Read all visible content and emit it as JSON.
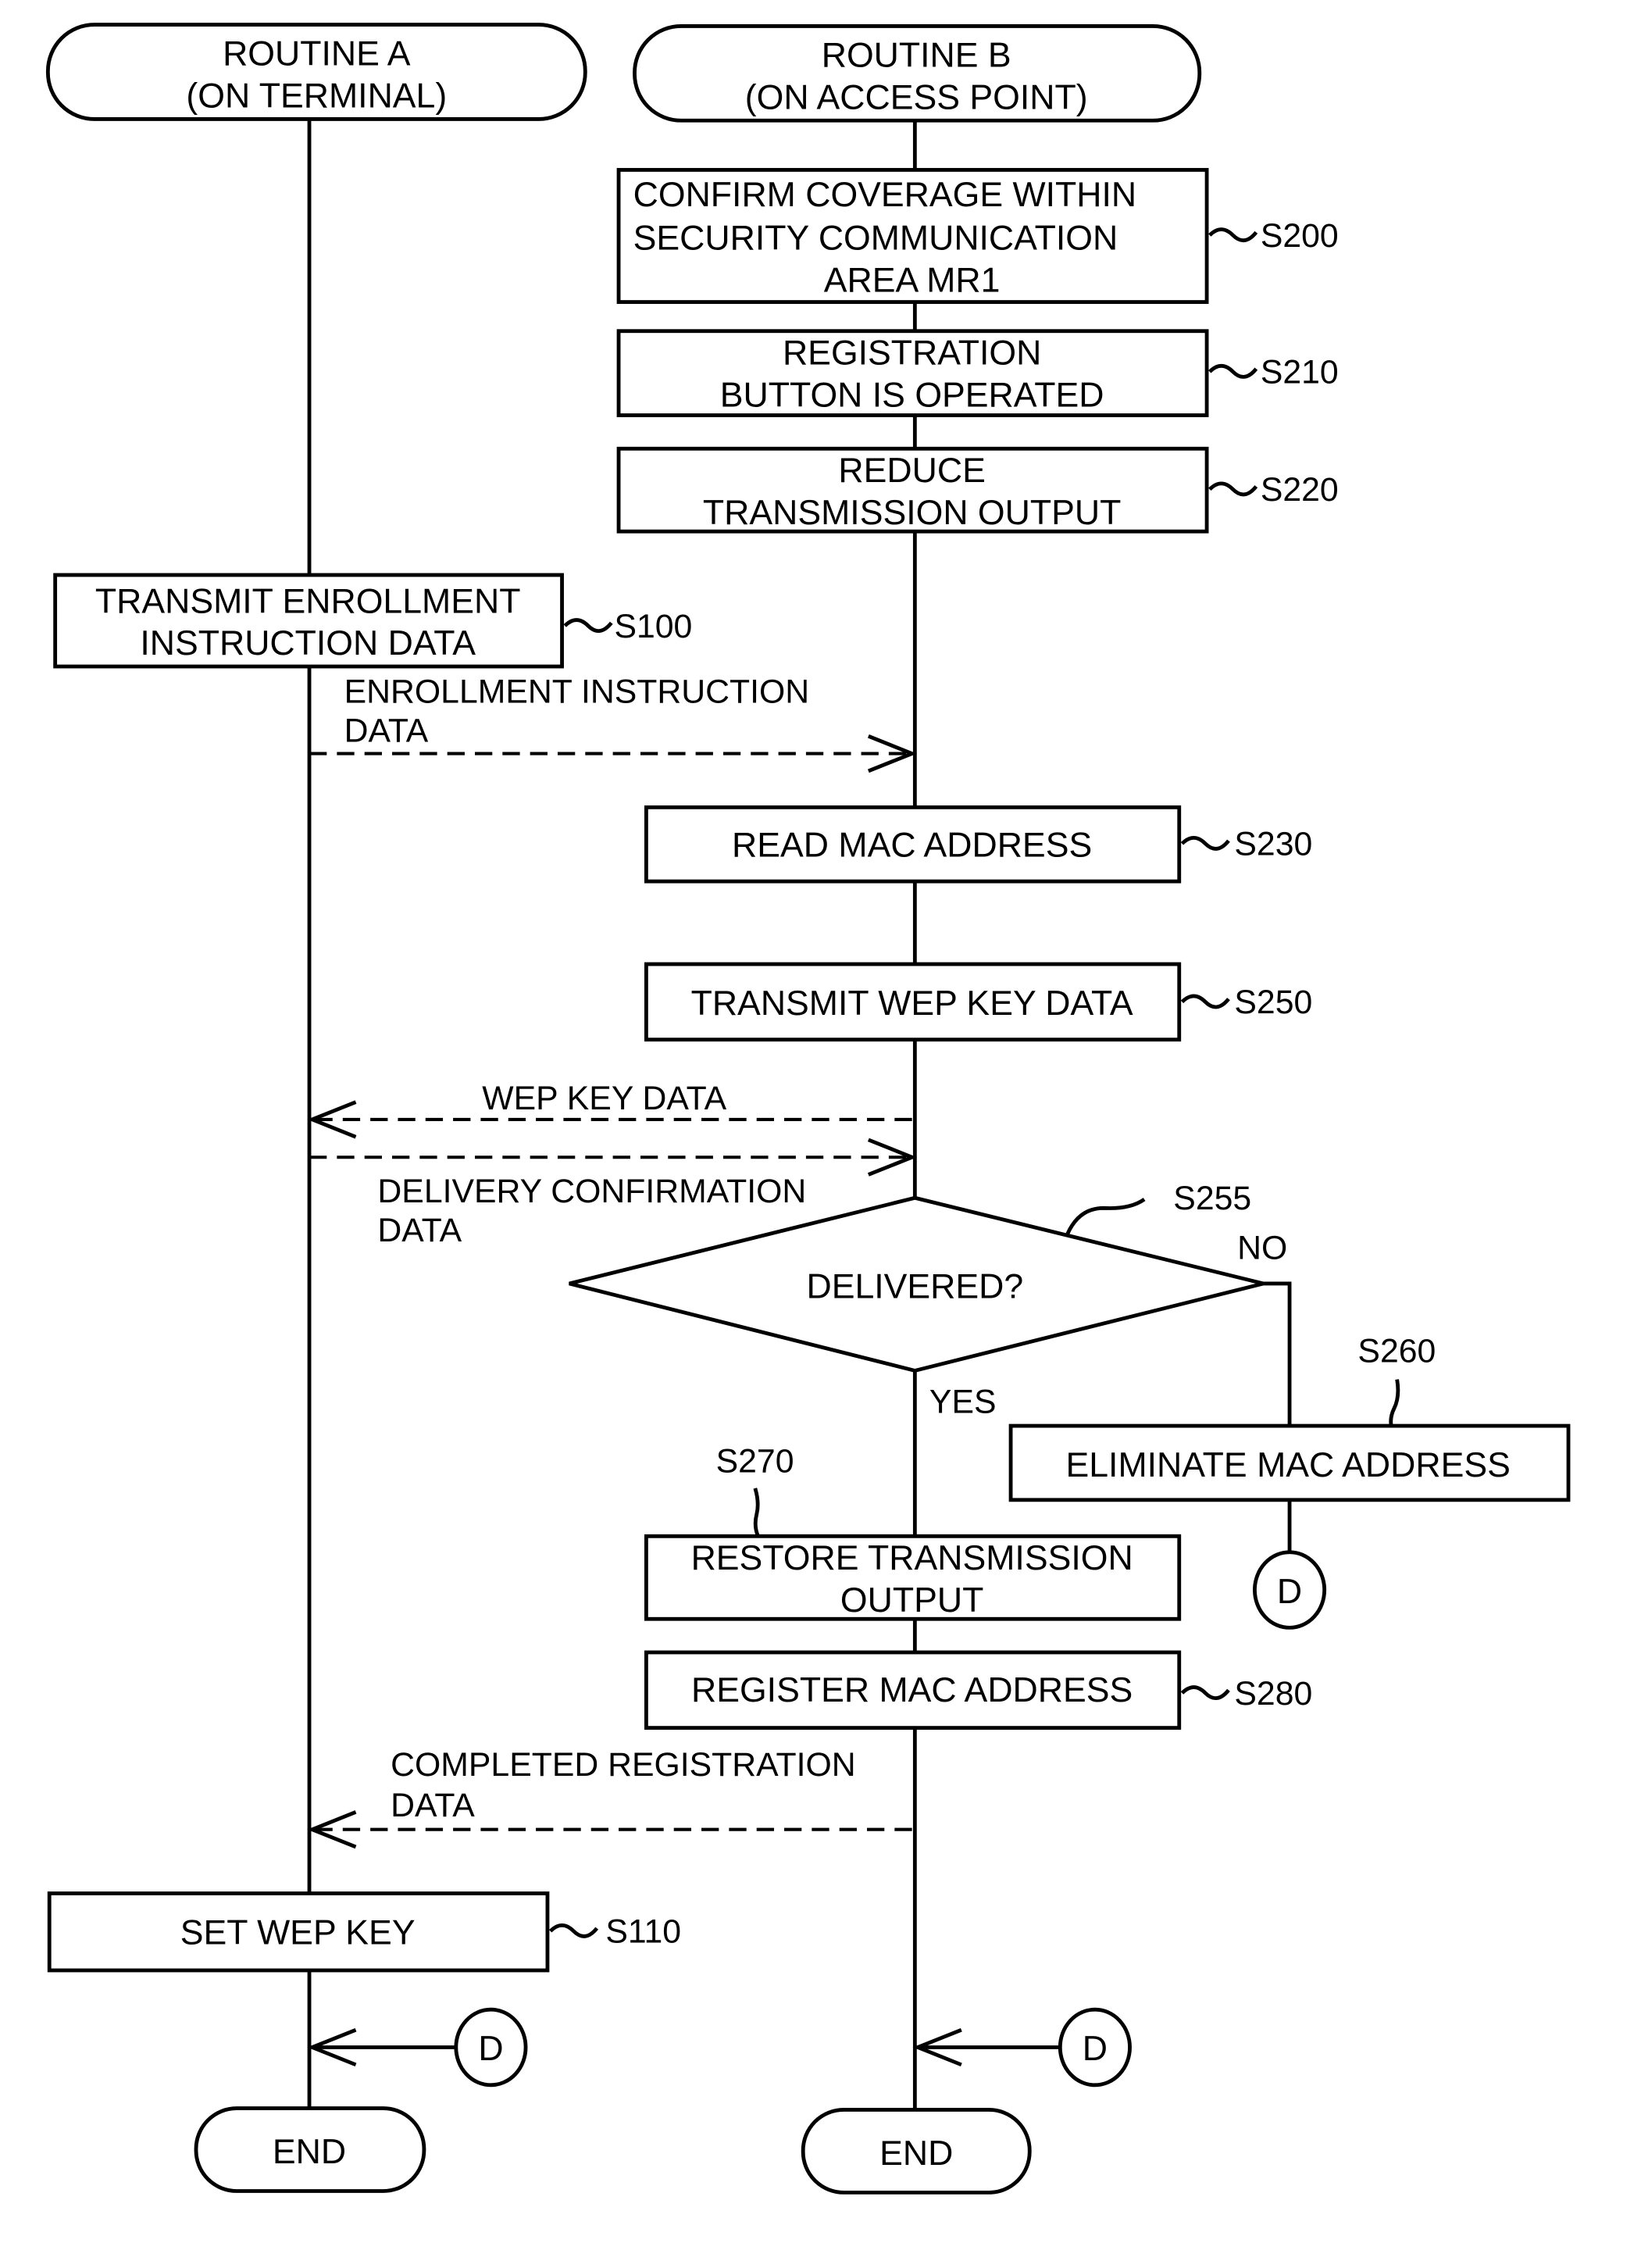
{
  "diagram": {
    "lanes": {
      "a": {
        "title_line1": "ROUTINE A",
        "title_line2": "(ON TERMINAL)",
        "end_label": "END"
      },
      "b": {
        "title_line1": "ROUTINE B",
        "title_line2": "(ON ACCESS POINT)",
        "end_label": "END"
      }
    },
    "steps": {
      "s200": {
        "id": "S200",
        "lines": [
          "CONFIRM COVERAGE WITHIN",
          "SECURITY COMMUNICATION",
          "AREA MR1"
        ]
      },
      "s210": {
        "id": "S210",
        "lines": [
          "REGISTRATION",
          "BUTTON IS OPERATED"
        ]
      },
      "s220": {
        "id": "S220",
        "lines": [
          "REDUCE",
          "TRANSMISSION OUTPUT"
        ]
      },
      "s100": {
        "id": "S100",
        "lines": [
          "TRANSMIT ENROLLMENT",
          "INSTRUCTION DATA"
        ]
      },
      "s230": {
        "id": "S230",
        "lines": [
          "READ MAC ADDRESS"
        ]
      },
      "s250": {
        "id": "S250",
        "lines": [
          "TRANSMIT WEP KEY DATA"
        ]
      },
      "s255": {
        "id": "S255",
        "question": "DELIVERED?",
        "yes_label": "YES",
        "no_label": "NO"
      },
      "s260": {
        "id": "S260",
        "lines": [
          "ELIMINATE MAC ADDRESS"
        ]
      },
      "s270": {
        "id": "S270",
        "lines": [
          "RESTORE TRANSMISSION",
          "OUTPUT"
        ]
      },
      "s280": {
        "id": "S280",
        "lines": [
          "REGISTER MAC ADDRESS"
        ]
      },
      "s110": {
        "id": "S110",
        "lines": [
          "SET WEP KEY"
        ]
      }
    },
    "messages": {
      "enrollment": {
        "lines": [
          "ENROLLMENT INSTRUCTION",
          "DATA"
        ],
        "direction": "A-to-B"
      },
      "wep_key": {
        "lines": [
          "WEP KEY DATA"
        ],
        "direction": "B-to-A"
      },
      "delivery": {
        "lines": [
          "DELIVERY CONFIRMATION",
          "DATA"
        ],
        "direction": "A-to-B"
      },
      "completed": {
        "lines": [
          "COMPLETED REGISTRATION",
          "DATA"
        ],
        "direction": "B-to-A"
      }
    },
    "connector_label": "D"
  }
}
